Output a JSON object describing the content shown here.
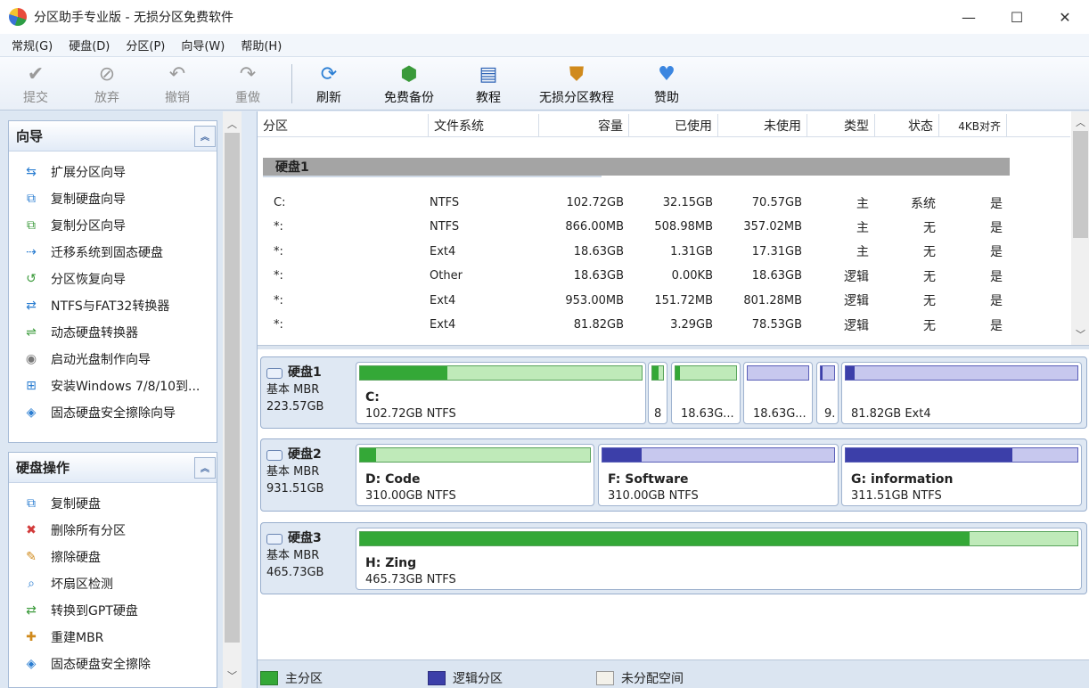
{
  "window": {
    "title": "分区助手专业版 - 无损分区免费软件",
    "minimize": "—",
    "maximize": "☐",
    "close": "✕"
  },
  "menu": [
    "常规(G)",
    "硬盘(D)",
    "分区(P)",
    "向导(W)",
    "帮助(H)"
  ],
  "toolbar": [
    {
      "label": "提交",
      "icon": "check-icon",
      "enabled": false
    },
    {
      "label": "放弃",
      "icon": "discard-icon",
      "enabled": false
    },
    {
      "label": "撤销",
      "icon": "undo-icon",
      "enabled": false
    },
    {
      "label": "重做",
      "icon": "redo-icon",
      "enabled": false
    },
    {
      "label": "刷新",
      "icon": "refresh-icon",
      "enabled": true
    },
    {
      "label": "免费备份",
      "icon": "backup-icon",
      "enabled": true
    },
    {
      "label": "教程",
      "icon": "tutorial-icon",
      "enabled": true
    },
    {
      "label": "无损分区教程",
      "icon": "shield-icon",
      "enabled": true
    },
    {
      "label": "赞助",
      "icon": "heart-icon",
      "enabled": true
    }
  ],
  "wizard_panel": {
    "title": "向导",
    "items": [
      "扩展分区向导",
      "复制硬盘向导",
      "复制分区向导",
      "迁移系统到固态硬盘",
      "分区恢复向导",
      "NTFS与FAT32转换器",
      "动态硬盘转换器",
      "启动光盘制作向导",
      "安装Windows 7/8/10到...",
      "固态硬盘安全擦除向导"
    ]
  },
  "disk_ops_panel": {
    "title": "硬盘操作",
    "items": [
      "复制硬盘",
      "删除所有分区",
      "擦除硬盘",
      "坏扇区检测",
      "转换到GPT硬盘",
      "重建MBR",
      "固态硬盘安全擦除"
    ]
  },
  "table": {
    "headers": [
      "分区",
      "文件系统",
      "容量",
      "已使用",
      "未使用",
      "类型",
      "状态",
      "4KB对齐"
    ],
    "disk_label": "硬盘1",
    "rows": [
      [
        "C:",
        "NTFS",
        "102.72GB",
        "32.15GB",
        "70.57GB",
        "主",
        "系统",
        "是"
      ],
      [
        "*:",
        "NTFS",
        "866.00MB",
        "508.98MB",
        "357.02MB",
        "主",
        "无",
        "是"
      ],
      [
        "*:",
        "Ext4",
        "18.63GB",
        "1.31GB",
        "17.31GB",
        "主",
        "无",
        "是"
      ],
      [
        "*:",
        "Other",
        "18.63GB",
        "0.00KB",
        "18.63GB",
        "逻辑",
        "无",
        "是"
      ],
      [
        "*:",
        "Ext4",
        "953.00MB",
        "151.72MB",
        "801.28MB",
        "逻辑",
        "无",
        "是"
      ],
      [
        "*:",
        "Ext4",
        "81.82GB",
        "3.29GB",
        "78.53GB",
        "逻辑",
        "无",
        "是"
      ]
    ]
  },
  "disks": [
    {
      "name": "硬盘1",
      "type": "基本 MBR",
      "size": "223.57GB",
      "partitions": [
        {
          "label": "C:",
          "info": "102.72GB NTFS",
          "kind": "primary",
          "used": 0.31
        },
        {
          "label": "",
          "info": "8",
          "kind": "primary",
          "used": 0.59
        },
        {
          "label": "",
          "info": "18.63G...",
          "kind": "primary",
          "used": 0.07
        },
        {
          "label": "",
          "info": "18.63G...",
          "kind": "logical",
          "used": 0.0
        },
        {
          "label": "",
          "info": "9.",
          "kind": "logical",
          "used": 0.16
        },
        {
          "label": "",
          "info": "81.82GB Ext4",
          "kind": "logical",
          "used": 0.04
        }
      ]
    },
    {
      "name": "硬盘2",
      "type": "基本 MBR",
      "size": "931.51GB",
      "partitions": [
        {
          "label": "D: Code",
          "info": "310.00GB NTFS",
          "kind": "primary",
          "used": 0.07
        },
        {
          "label": "F: Software",
          "info": "310.00GB NTFS",
          "kind": "logical",
          "used": 0.17
        },
        {
          "label": "G: information",
          "info": "311.51GB NTFS",
          "kind": "logical",
          "used": 0.72
        }
      ]
    },
    {
      "name": "硬盘3",
      "type": "基本 MBR",
      "size": "465.73GB",
      "partitions": [
        {
          "label": "H: Zing",
          "info": "465.73GB NTFS",
          "kind": "primary",
          "used": 0.85
        }
      ]
    }
  ],
  "legend": [
    "主分区",
    "逻辑分区",
    "未分配空间"
  ],
  "colors": {
    "primary": "#34a837",
    "logical": "#3c3fa9",
    "unallocated": "#f3f1ea"
  }
}
